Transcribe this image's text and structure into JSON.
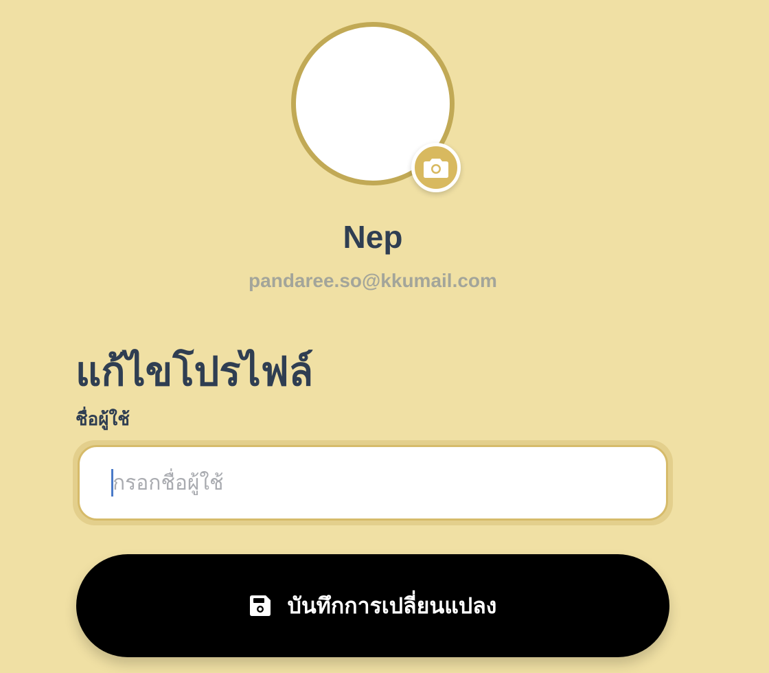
{
  "profile": {
    "name": "Nep",
    "email": "pandaree.so@kkumail.com"
  },
  "form": {
    "title": "แก้ไขโปรไฟล์",
    "username_label": "ชื่อผู้ใช้",
    "username_value": "",
    "username_placeholder": "กรอกชื่อผู้ใช้"
  },
  "actions": {
    "save_label": "บันทึกการเปลี่ยนแปลง"
  },
  "icons": {
    "camera": "camera-icon",
    "save": "floppy-disk-icon"
  },
  "colors": {
    "background": "#f0e0a4",
    "avatar_border": "#c1a955",
    "camera_badge": "#d8b95f",
    "heading": "#2f3e52",
    "muted": "#a3a59a",
    "button": "#000000"
  }
}
